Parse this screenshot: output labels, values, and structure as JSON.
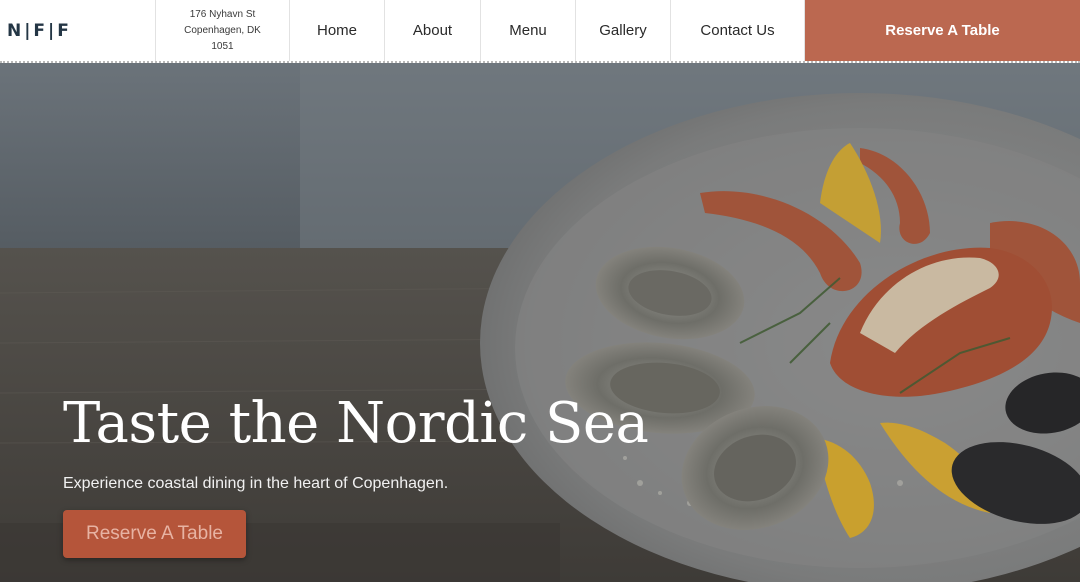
{
  "header": {
    "logo": "N|F|F",
    "address": {
      "line1": "176 Nyhavn St",
      "line2": "Copenhagen, DK",
      "line3": "1051"
    },
    "nav": [
      {
        "label": "Home"
      },
      {
        "label": "About"
      },
      {
        "label": "Menu"
      },
      {
        "label": "Gallery"
      },
      {
        "label": "Contact Us"
      }
    ],
    "cta_label": "Reserve A Table"
  },
  "hero": {
    "title": "Taste the Nordic Sea",
    "subtitle": "Experience coastal dining in the heart of Copenhagen.",
    "cta_label": "Reserve A Table",
    "image_icon": "seafood-platter-image"
  },
  "colors": {
    "brand_accent": "#bb6850",
    "hero_button": "#b5553a",
    "logo_text": "#243645"
  }
}
